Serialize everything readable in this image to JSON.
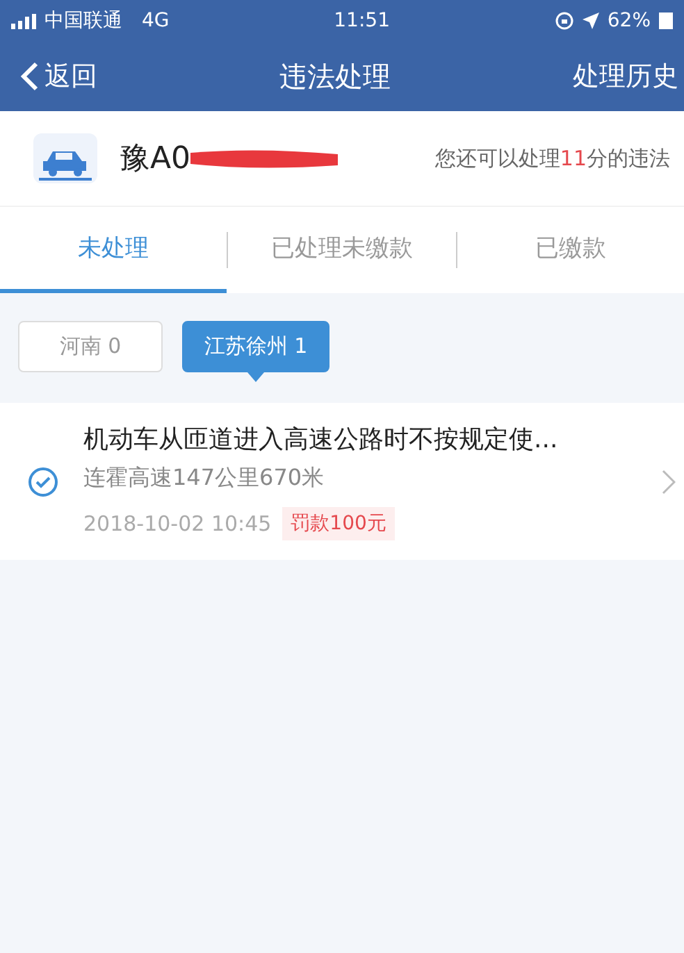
{
  "status_bar": {
    "carrier": "中国联通",
    "network": "4G",
    "time": "11:51",
    "battery": "62%"
  },
  "nav": {
    "back": "返回",
    "title": "违法处理",
    "action": "处理历史"
  },
  "vehicle": {
    "plate": "豫A0",
    "quota": {
      "prefix": "您还可以处理",
      "points": "11",
      "suffix": "分的违法"
    }
  },
  "tabs": [
    {
      "label": "未处理",
      "selected": true
    },
    {
      "label": "已处理未缴款",
      "selected": false
    },
    {
      "label": "已缴款",
      "selected": false
    }
  ],
  "regions": [
    {
      "label": "河南 0",
      "selected": false
    },
    {
      "label": "江苏徐州 1",
      "selected": true
    }
  ],
  "violations": [
    {
      "title": "机动车从匝道进入高速公路时不按规定使...",
      "location": "连霍高速147公里670米",
      "time": "2018-10-02 10:45",
      "fine": "罚款100元",
      "checked": true
    }
  ]
}
